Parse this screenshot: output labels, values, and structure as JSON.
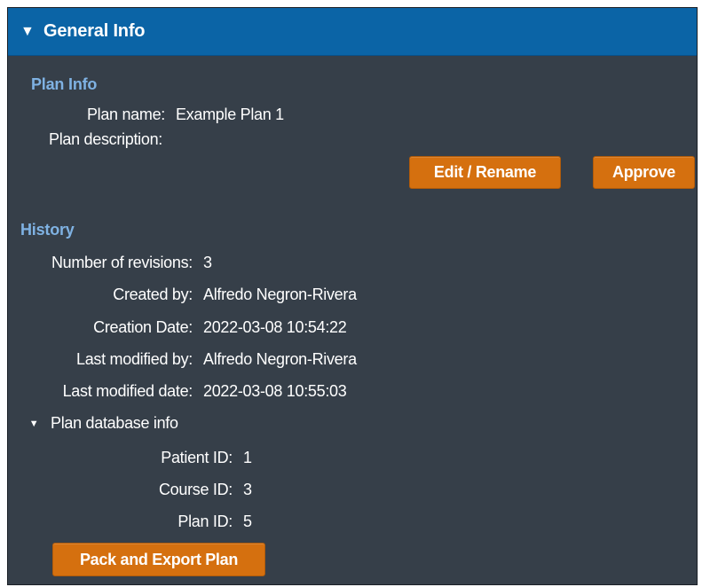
{
  "header": {
    "caret": "▼",
    "title": "General Info"
  },
  "plan_info": {
    "title": "Plan Info",
    "name_label": "Plan name:",
    "name_value": "Example Plan 1",
    "description_label": "Plan description:",
    "description_value": "",
    "edit_button": "Edit / Rename",
    "approve_button": "Approve"
  },
  "history": {
    "title": "History",
    "revisions_label": "Number of revisions:",
    "revisions_value": "3",
    "created_by_label": "Created by:",
    "created_by_value": "Alfredo Negron-Rivera",
    "creation_date_label": "Creation Date:",
    "creation_date_value": "2022-03-08 10:54:22",
    "last_modified_by_label": "Last modified by:",
    "last_modified_by_value": "Alfredo Negron-Rivera",
    "last_modified_date_label": "Last modified date:",
    "last_modified_date_value": "2022-03-08 10:55:03"
  },
  "database_info": {
    "caret": "▼",
    "toggle_label": "Plan database info",
    "patient_id_label": "Patient ID:",
    "patient_id_value": "1",
    "course_id_label": "Course ID:",
    "course_id_value": "3",
    "plan_id_label": "Plan ID:",
    "plan_id_value": "5"
  },
  "export_button": "Pack and Export Plan"
}
